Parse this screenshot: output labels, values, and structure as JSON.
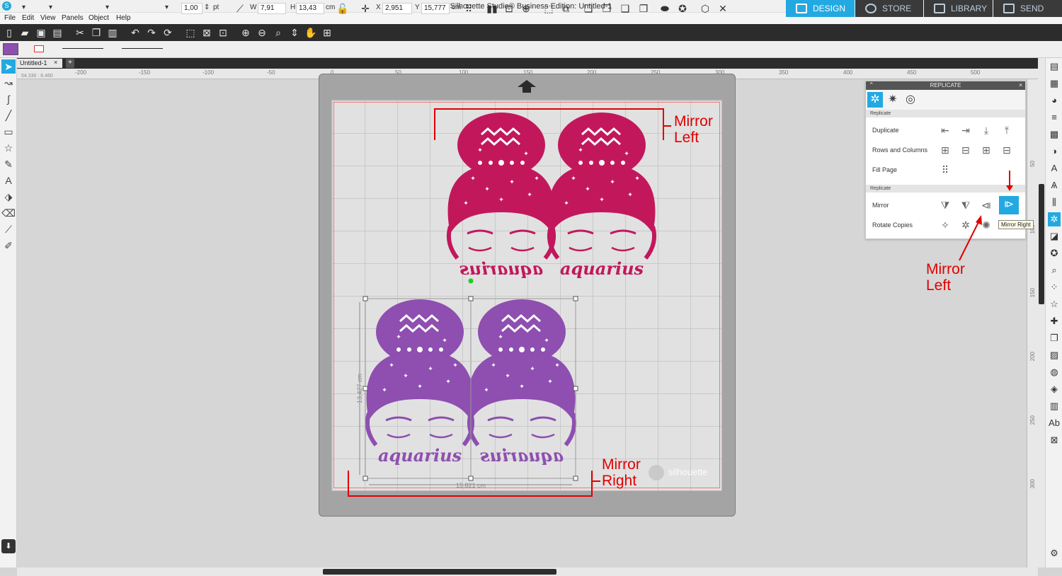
{
  "window": {
    "title": "Silhouette Studio® Business Edition: Untitled-1",
    "minimize": "–",
    "maximize": "⧉",
    "close": "✕"
  },
  "menu": [
    "File",
    "Edit",
    "View",
    "Panels",
    "Object",
    "Help"
  ],
  "nav": {
    "design": "DESIGN",
    "store": "STORE",
    "library": "LIBRARY",
    "send": "SEND",
    "active": "design"
  },
  "toolbar2": {
    "line_weight": "1,00",
    "line_unit": "pt",
    "w_label": "W",
    "w_value": "7,91",
    "h_label": "H",
    "h_value": "13,43",
    "size_unit": "cm",
    "x_label": "X",
    "x_value": "2,951",
    "y_label": "Y",
    "y_value": "15,777",
    "pos_unit": "cm"
  },
  "tabs": {
    "document": "Untitled-1",
    "close": "×",
    "add": "+"
  },
  "cursor_coords": "54.330 : 6.460",
  "ruler_h": [
    "-200",
    "-150",
    "-100",
    "-50",
    "0",
    "50",
    "100",
    "150",
    "200",
    "250",
    "300",
    "350",
    "400",
    "450",
    "500"
  ],
  "ruler_v": [
    "50",
    "100",
    "150",
    "200",
    "250",
    "300"
  ],
  "artwork": {
    "text": "aquarius",
    "colors": {
      "top": "#c2185b",
      "bottom": "#8e4fb0",
      "selection": "#999999",
      "handle_green": "#22cc22"
    },
    "dimension_w": "15,821 cm",
    "dimension_h": "13,427 cm"
  },
  "watermark": "silhouette",
  "annotations": {
    "top": "Mirror\nLeft",
    "bottom": "Mirror\nRight",
    "panel": "Mirror\nLeft",
    "color": "#e00000"
  },
  "replicate_panel": {
    "title": "REPLICATE",
    "close": "×",
    "section1": "Replicate",
    "rows1": [
      "Duplicate",
      "Rows and Columns",
      "Fill Page"
    ],
    "section2": "Replicate",
    "rows2": [
      "Mirror",
      "Rotate Copies"
    ],
    "tooltip": "Mirror Right",
    "active_color": "#23a9e1"
  }
}
